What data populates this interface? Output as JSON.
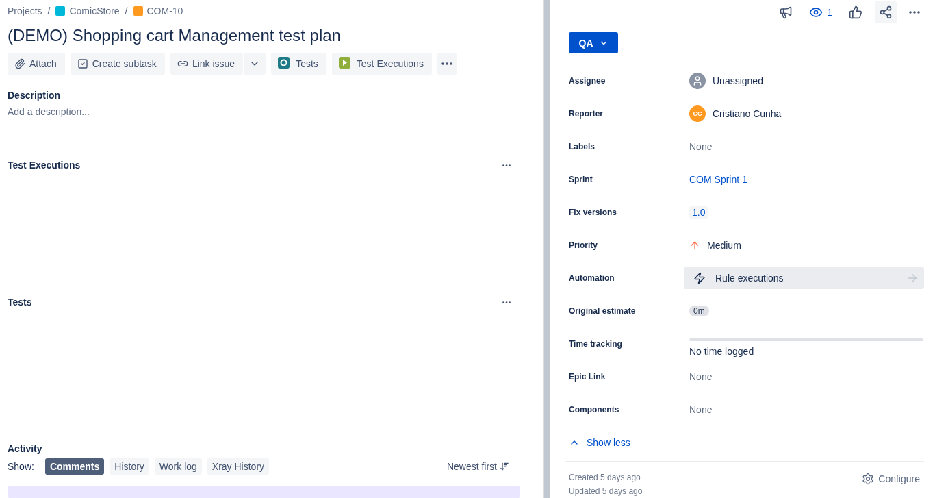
{
  "breadcrumbs": [
    {
      "label": "Projects",
      "kind": "text"
    },
    {
      "label": "ComicStore",
      "kind": "project",
      "separator": "/"
    },
    {
      "label": "COM-10",
      "kind": "issue",
      "separator": "/"
    }
  ],
  "title": "(DEMO) Shopping cart Management test plan",
  "toolbar": [
    {
      "label": "Attach",
      "kind": "attach"
    },
    {
      "label": "Create subtask",
      "kind": "subtask"
    },
    {
      "label": "Link issue",
      "kind": "link"
    },
    {
      "label": "Tests",
      "kind": "tests"
    },
    {
      "label": "Test Executions",
      "kind": "executions"
    }
  ],
  "description": {
    "heading": "Description",
    "placeholder": "Add a description..."
  },
  "sections": [
    {
      "heading": "Test Executions"
    },
    {
      "heading": "Tests"
    }
  ],
  "activity": {
    "heading": "Activity",
    "show_label": "Show:",
    "tabs": [
      {
        "label": "Comments",
        "selected": true
      },
      {
        "label": "History",
        "selected": false
      },
      {
        "label": "Work log",
        "selected": false
      },
      {
        "label": "Xray History",
        "selected": false
      }
    ],
    "sort": "Newest first"
  },
  "header_actions": {
    "watchers": "1"
  },
  "status": "QA",
  "fields": [
    {
      "label": "Assignee",
      "kind": "user",
      "value": "Unassigned"
    },
    {
      "label": "Reporter",
      "kind": "avatar",
      "value": "Cristiano Cunha",
      "initials": "CC"
    },
    {
      "label": "Labels",
      "kind": "text",
      "value": "None"
    },
    {
      "label": "Sprint",
      "kind": "link",
      "value": "COM Sprint 1"
    },
    {
      "label": "Fix versions",
      "kind": "version",
      "value": "1.0"
    },
    {
      "label": "Priority",
      "kind": "priority",
      "value": "Medium"
    },
    {
      "label": "Automation",
      "kind": "automation",
      "value": "Rule executions"
    },
    {
      "label": "Original estimate",
      "kind": "estimate",
      "value": "0m"
    },
    {
      "label": "Time tracking",
      "kind": "tracking",
      "value": "No time logged",
      "level": 0
    },
    {
      "label": "Epic Link",
      "kind": "text",
      "value": "None"
    },
    {
      "label": "Components",
      "kind": "text",
      "value": "None"
    }
  ],
  "show_less": "Show less",
  "footer": {
    "created": "Created 5 days ago",
    "updated": "Updated 5 days ago",
    "configure": "Configure"
  }
}
